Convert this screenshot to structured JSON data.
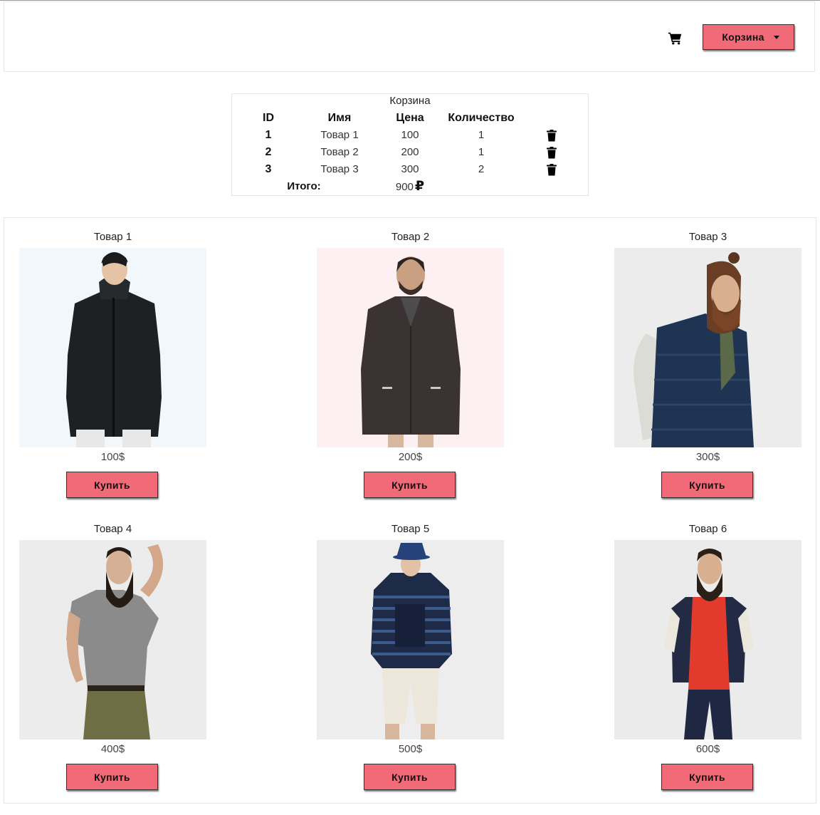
{
  "header": {
    "cart_button_label": "Корзина",
    "cart_icon": "shopping-cart-icon"
  },
  "cart": {
    "title": "Корзина",
    "columns": [
      "ID",
      "Имя",
      "Цена",
      "Количество"
    ],
    "rows": [
      {
        "id": "1",
        "name": "Товар 1",
        "price": "100",
        "qty": "1"
      },
      {
        "id": "2",
        "name": "Товар 2",
        "price": "200",
        "qty": "1"
      },
      {
        "id": "3",
        "name": "Товар 3",
        "price": "300",
        "qty": "2"
      }
    ],
    "delete_icon": "trash-icon",
    "total_label": "Итого:",
    "total_value": "900",
    "currency": "₽"
  },
  "products": [
    {
      "title": "Товар 1",
      "price": "100$",
      "buy_label": "Купить",
      "bg": "#f2f7fb",
      "outfit": "black-hooded-coat"
    },
    {
      "title": "Товар 2",
      "price": "200$",
      "buy_label": "Купить",
      "bg": "#fcf0f2",
      "outfit": "dark-wool-coat"
    },
    {
      "title": "Товар 3",
      "price": "300$",
      "buy_label": "Купить",
      "bg": "#ececec",
      "outfit": "navy-puffer-jacket"
    },
    {
      "title": "Товар 4",
      "price": "400$",
      "buy_label": "Купить",
      "bg": "#ececec",
      "outfit": "grey-tshirt-olive-shorts"
    },
    {
      "title": "Товар 5",
      "price": "500$",
      "buy_label": "Купить",
      "bg": "#ededed",
      "outfit": "striped-hoodie-white-shorts"
    },
    {
      "title": "Товар 6",
      "price": "600$",
      "buy_label": "Купить",
      "bg": "#ebebeb",
      "outfit": "red-tee-bomber-jacket"
    }
  ],
  "colors": {
    "accent": "#f06a78",
    "border": "#e7e7e7"
  }
}
